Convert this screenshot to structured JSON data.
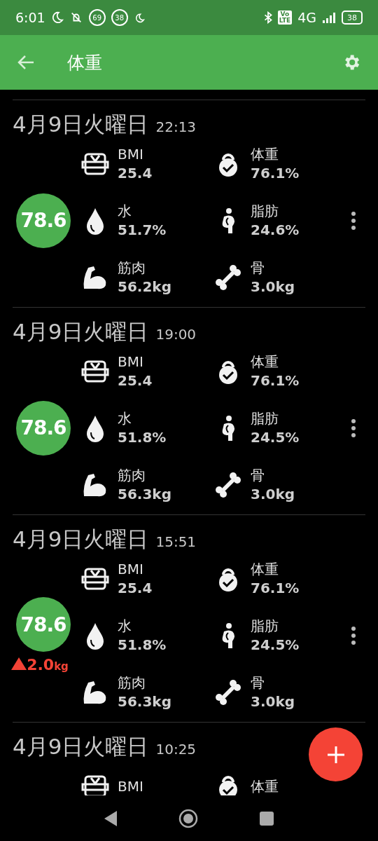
{
  "status_bar": {
    "time": "6:01",
    "badges": [
      "69",
      "38"
    ],
    "volte": [
      "Vo",
      "LTE"
    ],
    "network": "4G",
    "battery": "38"
  },
  "app_bar": {
    "title": "体重"
  },
  "entries": [
    {
      "date": "4月9日火曜日",
      "time": "22:13",
      "score": "78.6",
      "metrics": [
        {
          "kind": "bmi",
          "label": "BMI",
          "value": "25.4"
        },
        {
          "kind": "weight",
          "label": "体重",
          "value": "76.1%"
        },
        {
          "kind": "water",
          "label": "水",
          "value": "51.7%"
        },
        {
          "kind": "fat",
          "label": "脂肪",
          "value": "24.6%"
        },
        {
          "kind": "muscle",
          "label": "筋肉",
          "value": "56.2kg"
        },
        {
          "kind": "bone",
          "label": "骨",
          "value": "3.0kg"
        }
      ]
    },
    {
      "date": "4月9日火曜日",
      "time": "19:00",
      "score": "78.6",
      "metrics": [
        {
          "kind": "bmi",
          "label": "BMI",
          "value": "25.4"
        },
        {
          "kind": "weight",
          "label": "体重",
          "value": "76.1%"
        },
        {
          "kind": "water",
          "label": "水",
          "value": "51.8%"
        },
        {
          "kind": "fat",
          "label": "脂肪",
          "value": "24.5%"
        },
        {
          "kind": "muscle",
          "label": "筋肉",
          "value": "56.3kg"
        },
        {
          "kind": "bone",
          "label": "骨",
          "value": "3.0kg"
        }
      ]
    },
    {
      "date": "4月9日火曜日",
      "time": "15:51",
      "score": "78.6",
      "change": {
        "amount": "2.0",
        "unit": "kg"
      },
      "metrics": [
        {
          "kind": "bmi",
          "label": "BMI",
          "value": "25.4"
        },
        {
          "kind": "weight",
          "label": "体重",
          "value": "76.1%"
        },
        {
          "kind": "water",
          "label": "水",
          "value": "51.8%"
        },
        {
          "kind": "fat",
          "label": "脂肪",
          "value": "24.5%"
        },
        {
          "kind": "muscle",
          "label": "筋肉",
          "value": "56.3kg"
        },
        {
          "kind": "bone",
          "label": "骨",
          "value": "3.0kg"
        }
      ]
    },
    {
      "date": "4月9日火曜日",
      "time": "10:25",
      "metrics": [
        {
          "kind": "bmi",
          "label": "BMI"
        },
        {
          "kind": "weight",
          "label": "体重"
        }
      ]
    }
  ]
}
